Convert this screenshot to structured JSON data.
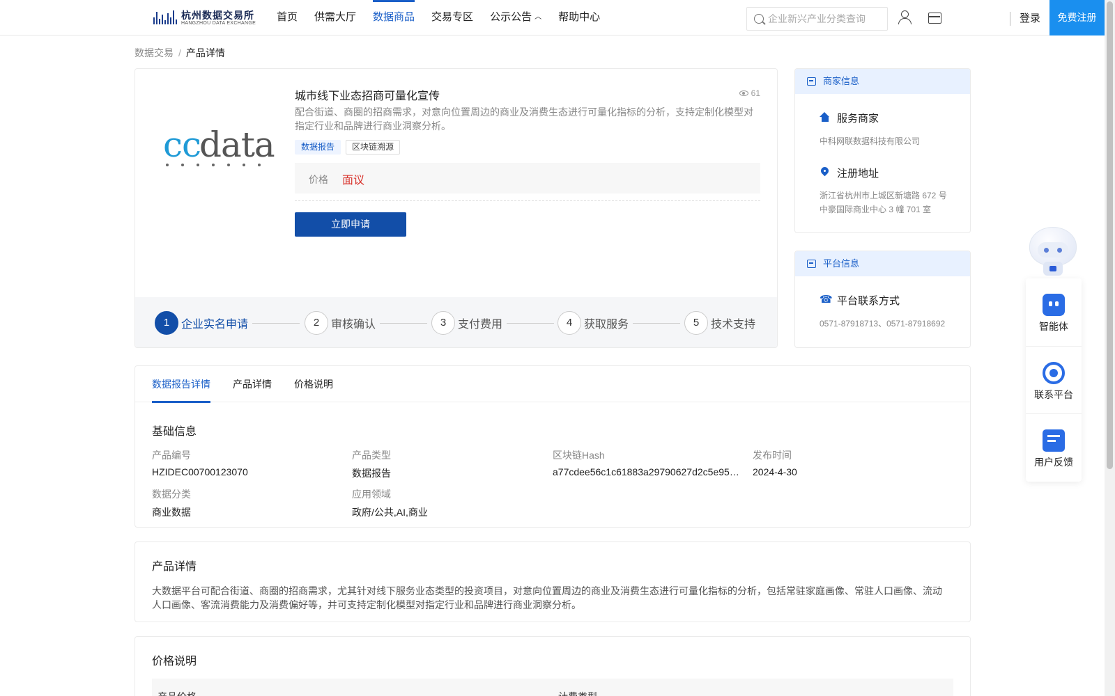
{
  "header": {
    "logo_cn": "杭州数据交易所",
    "logo_en": "HANGZHOU DATA EXCHANGE",
    "nav": [
      {
        "label": "首页"
      },
      {
        "label": "供需大厅"
      },
      {
        "label": "数据商品",
        "active": true
      },
      {
        "label": "交易专区"
      },
      {
        "label": "公示公告"
      },
      {
        "label": "帮助中心"
      }
    ],
    "search_placeholder": "企业新兴产业分类查询",
    "login": "登录",
    "register": "免费注册"
  },
  "breadcrumb": {
    "parent": "数据交易",
    "separator": "/",
    "current": "产品详情"
  },
  "product": {
    "logo_text_part1": "cc",
    "logo_text_part2": "data",
    "title": "城市线下业态招商可量化宣传",
    "views": "61",
    "description": "配合街道、商圈的招商需求，对意向位置周边的商业及消费生态进行可量化指标的分析，支持定制化模型对指定行业和品牌进行商业洞察分析。",
    "tags": [
      "数据报告",
      "区块链溯源"
    ],
    "price_label": "价格",
    "price_value": "面议",
    "apply_button": "立即申请",
    "steps": [
      {
        "num": "1",
        "label": "企业实名申请"
      },
      {
        "num": "2",
        "label": "审核确认"
      },
      {
        "num": "3",
        "label": "支付费用"
      },
      {
        "num": "4",
        "label": "获取服务"
      },
      {
        "num": "5",
        "label": "技术支持"
      }
    ]
  },
  "merchant": {
    "header": "商家信息",
    "service_title": "服务商家",
    "service_value": "中科网联数据科技有限公司",
    "address_title": "注册地址",
    "address_line1": "浙江省杭州市上城区新塘路 672 号",
    "address_line2": "中豪国际商业中心 3 幢 701 室"
  },
  "platform": {
    "header": "平台信息",
    "contact_title": "平台联系方式",
    "contact_value": "0571-87918713、0571-87918692"
  },
  "tabs": [
    "数据报告详情",
    "产品详情",
    "价格说明"
  ],
  "basic_info": {
    "title": "基础信息",
    "fields": [
      {
        "key": "产品编号",
        "value": "HZIDEC00700123070"
      },
      {
        "key": "产品类型",
        "value": "数据报告"
      },
      {
        "key": "区块链Hash",
        "value": "a77cdee56c1c61883a29790627d2c5e954..."
      },
      {
        "key": "发布时间",
        "value": "2024-4-30"
      },
      {
        "key": "数据分类",
        "value": "商业数据"
      },
      {
        "key": "应用领域",
        "value": "政府/公共,AI,商业"
      }
    ]
  },
  "product_detail": {
    "title": "产品详情",
    "text": " 大数据平台可配合街道、商圈的招商需求，尤其针对线下服务业态类型的投资项目，对意向位置周边的商业及消费生态进行可量化指标的分析，包括常驻家庭画像、常驻人口画像、流动人口画像、客流消费能力及消费偏好等，并可支持定制化模型对指定行业和品牌进行商业洞察分析。"
  },
  "price_desc": {
    "title": "价格说明",
    "col1": "产品价格",
    "col2": "计费类型"
  },
  "float_widget": {
    "items": [
      {
        "label": "智能体"
      },
      {
        "label": "联系平台"
      },
      {
        "label": "用户反馈"
      }
    ]
  }
}
